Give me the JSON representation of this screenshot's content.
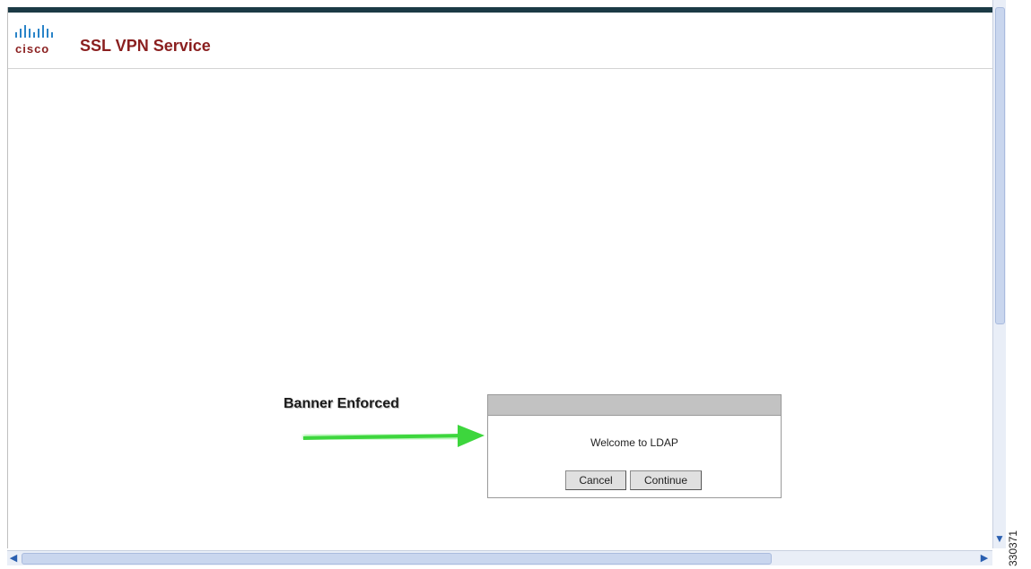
{
  "header": {
    "logo_text": "cisco",
    "app_title": "SSL VPN Service"
  },
  "annotation": {
    "label": "Banner Enforced"
  },
  "dialog": {
    "message": "Welcome to LDAP",
    "cancel_label": "Cancel",
    "continue_label": "Continue"
  },
  "figure": {
    "id": "330371"
  },
  "colors": {
    "brand": "#8a1f1f",
    "top_band": "#1b3a45",
    "arrow": "#3dd63d"
  },
  "icons": {
    "logo": "cisco-logo-icon",
    "arrow": "green-arrow-icon"
  }
}
